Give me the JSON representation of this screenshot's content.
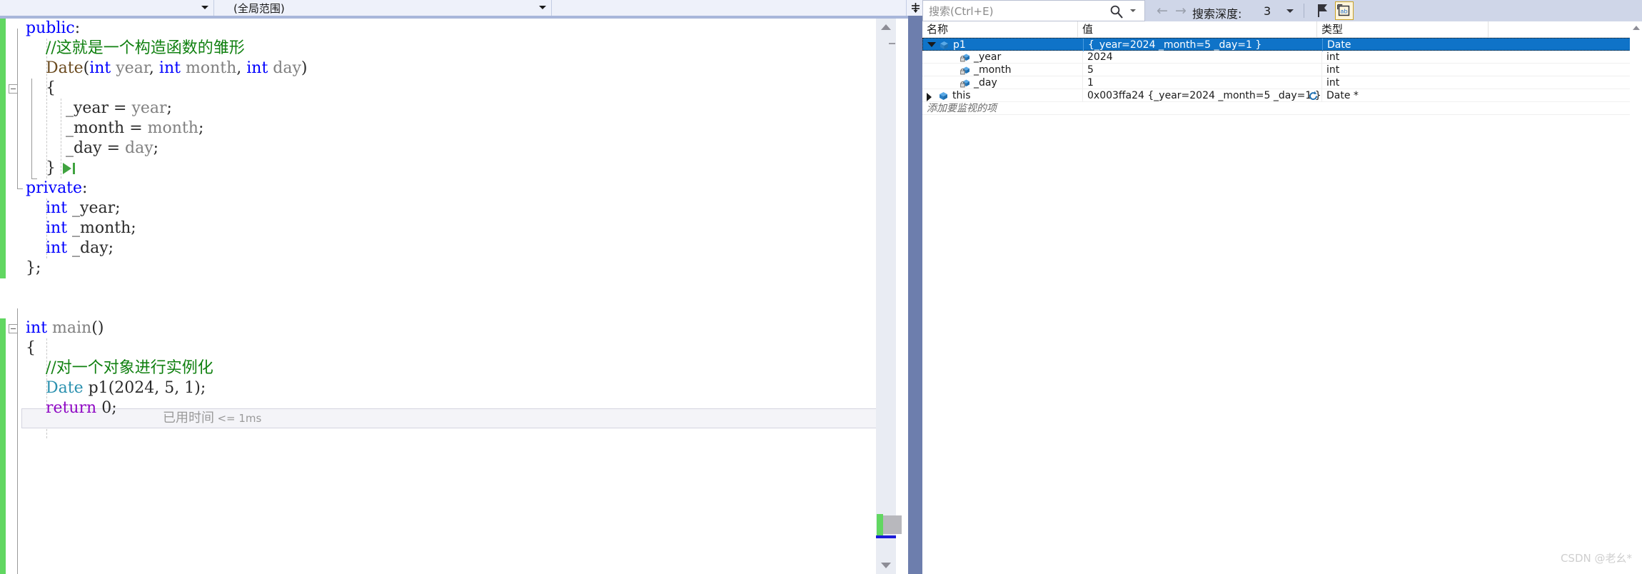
{
  "editor": {
    "combo_project": "",
    "combo_scope": "(全局范围)",
    "combo_member": "",
    "lines": [
      {
        "indent": 0,
        "segments": [
          {
            "t": "public",
            "c": "kw"
          },
          {
            "t": ":",
            "c": "punct"
          }
        ]
      },
      {
        "indent": 0,
        "segments": [
          {
            "t": "    //这就是一个构造函数的雏形",
            "c": "cmt"
          }
        ]
      },
      {
        "indent": 0,
        "segments": [
          {
            "t": "    ",
            "c": "plain"
          },
          {
            "t": "Date",
            "c": "brown"
          },
          {
            "t": "(",
            "c": "punct"
          },
          {
            "t": "int",
            "c": "kw"
          },
          {
            "t": " year",
            "c": "ident"
          },
          {
            "t": ", ",
            "c": "punct"
          },
          {
            "t": "int",
            "c": "kw"
          },
          {
            "t": " month",
            "c": "ident"
          },
          {
            "t": ", ",
            "c": "punct"
          },
          {
            "t": "int",
            "c": "kw"
          },
          {
            "t": " day",
            "c": "ident"
          },
          {
            "t": ")",
            "c": "punct"
          }
        ]
      },
      {
        "indent": 0,
        "segments": [
          {
            "t": "    {",
            "c": "punct"
          }
        ]
      },
      {
        "indent": 0,
        "segments": [
          {
            "t": "        _year",
            "c": "plain"
          },
          {
            "t": " = ",
            "c": "punct"
          },
          {
            "t": "year",
            "c": "ident"
          },
          {
            "t": ";",
            "c": "punct"
          }
        ]
      },
      {
        "indent": 0,
        "segments": [
          {
            "t": "        _month",
            "c": "plain"
          },
          {
            "t": " = ",
            "c": "punct"
          },
          {
            "t": "month",
            "c": "ident"
          },
          {
            "t": ";",
            "c": "punct"
          }
        ]
      },
      {
        "indent": 0,
        "segments": [
          {
            "t": "        _day",
            "c": "plain"
          },
          {
            "t": " = ",
            "c": "punct"
          },
          {
            "t": "day",
            "c": "ident"
          },
          {
            "t": ";",
            "c": "punct"
          }
        ]
      },
      {
        "indent": 0,
        "segments": [
          {
            "t": "    }",
            "c": "punct"
          }
        ]
      },
      {
        "indent": 0,
        "segments": [
          {
            "t": "private",
            "c": "kw"
          },
          {
            "t": ":",
            "c": "punct"
          }
        ]
      },
      {
        "indent": 0,
        "segments": [
          {
            "t": "    ",
            "c": "plain"
          },
          {
            "t": "int",
            "c": "kw"
          },
          {
            "t": " _year;",
            "c": "plain"
          }
        ]
      },
      {
        "indent": 0,
        "segments": [
          {
            "t": "    ",
            "c": "plain"
          },
          {
            "t": "int",
            "c": "kw"
          },
          {
            "t": " _month;",
            "c": "plain"
          }
        ]
      },
      {
        "indent": 0,
        "segments": [
          {
            "t": "    ",
            "c": "plain"
          },
          {
            "t": "int",
            "c": "kw"
          },
          {
            "t": " _day;",
            "c": "plain"
          }
        ]
      },
      {
        "indent": 0,
        "segments": [
          {
            "t": "};",
            "c": "punct"
          }
        ]
      },
      {
        "indent": 0,
        "segments": [
          {
            "t": "",
            "c": "plain"
          }
        ]
      },
      {
        "indent": 0,
        "segments": [
          {
            "t": "",
            "c": "plain"
          }
        ]
      },
      {
        "indent": 0,
        "segments": [
          {
            "t": "int",
            "c": "kw"
          },
          {
            "t": " ",
            "c": "plain"
          },
          {
            "t": "main",
            "c": "ident"
          },
          {
            "t": "()",
            "c": "punct"
          }
        ]
      },
      {
        "indent": 0,
        "segments": [
          {
            "t": "{",
            "c": "punct"
          }
        ]
      },
      {
        "indent": 0,
        "segments": [
          {
            "t": "    //对一个对象进行实例化",
            "c": "cmt"
          }
        ]
      },
      {
        "indent": 0,
        "segments": [
          {
            "t": "    ",
            "c": "plain"
          },
          {
            "t": "Date",
            "c": "typ"
          },
          {
            "t": " p1",
            "c": "plain"
          },
          {
            "t": "(",
            "c": "punct"
          },
          {
            "t": "2024",
            "c": "plain"
          },
          {
            "t": ", ",
            "c": "punct"
          },
          {
            "t": "5",
            "c": "plain"
          },
          {
            "t": ", ",
            "c": "punct"
          },
          {
            "t": "1",
            "c": "plain"
          },
          {
            "t": ");",
            "c": "punct"
          }
        ]
      },
      {
        "indent": 0,
        "segments": [
          {
            "t": "    ",
            "c": "plain"
          },
          {
            "t": "return",
            "c": "kw2"
          },
          {
            "t": " ",
            "c": "plain"
          },
          {
            "t": "0",
            "c": "plain"
          },
          {
            "t": ";",
            "c": "punct"
          }
        ]
      }
    ],
    "elapsed_label": "已用时间",
    "elapsed_value": "<= 1ms"
  },
  "watch": {
    "search_placeholder": "搜索(Ctrl+E)",
    "depth_label": "搜索深度:",
    "depth_value": "3",
    "columns": [
      "名称",
      "值",
      "类型"
    ],
    "rows": [
      {
        "name": "p1",
        "value": "{_year=2024 _month=5 _day=1 }",
        "type": "Date",
        "indent": 0,
        "expander": "open",
        "icon": "object-icon",
        "selected": true,
        "refresh": false
      },
      {
        "name": "_year",
        "value": "2024",
        "type": "int",
        "indent": 1,
        "expander": "none",
        "icon": "field-icon",
        "selected": false,
        "refresh": false
      },
      {
        "name": "_month",
        "value": "5",
        "type": "int",
        "indent": 1,
        "expander": "none",
        "icon": "field-icon",
        "selected": false,
        "refresh": false
      },
      {
        "name": "_day",
        "value": "1",
        "type": "int",
        "indent": 1,
        "expander": "none",
        "icon": "field-icon",
        "selected": false,
        "refresh": false
      },
      {
        "name": "this",
        "value": "0x003ffa24 {_year=2024 _month=5 _day=1 }",
        "type": "Date *",
        "indent": 0,
        "expander": "closed",
        "icon": "object-icon",
        "selected": false,
        "refresh": true
      }
    ],
    "add_watch_text": "添加要监视的项"
  },
  "watermark": "CSDN @老幺*"
}
